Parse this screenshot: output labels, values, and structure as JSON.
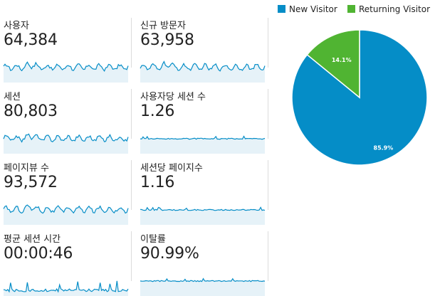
{
  "metrics": [
    {
      "id": "users",
      "label": "사용자",
      "value": "64,384",
      "style": "volatile"
    },
    {
      "id": "new-users",
      "label": "신규 방문자",
      "value": "63,958",
      "style": "volatile"
    },
    {
      "id": "sessions",
      "label": "세션",
      "value": "80,803",
      "style": "volatile"
    },
    {
      "id": "sessions-per-user",
      "label": "사용자당 세션 수",
      "value": "1.26",
      "style": "flat"
    },
    {
      "id": "pageviews",
      "label": "페이지뷰 수",
      "value": "93,572",
      "style": "volatile"
    },
    {
      "id": "pages-per-session",
      "label": "세션당 페이지수",
      "value": "1.16",
      "style": "flat"
    },
    {
      "id": "avg-session-duration",
      "label": "평균 세션 시간",
      "value": "00:00:46",
      "style": "spiky"
    },
    {
      "id": "bounce-rate",
      "label": "이탈률",
      "value": "90.99%",
      "style": "flat"
    }
  ],
  "chart_data": {
    "type": "pie",
    "categories": [
      "New Visitor",
      "Returning Visitor"
    ],
    "values": [
      85.9,
      14.1
    ],
    "data_labels": [
      "85.9%",
      "14.1%"
    ],
    "colors": [
      "#058dc7",
      "#50b432"
    ],
    "legend": "top"
  },
  "colors": {
    "sparkline": "#058dc7",
    "sparkline_fill": "#e6f2f8"
  }
}
